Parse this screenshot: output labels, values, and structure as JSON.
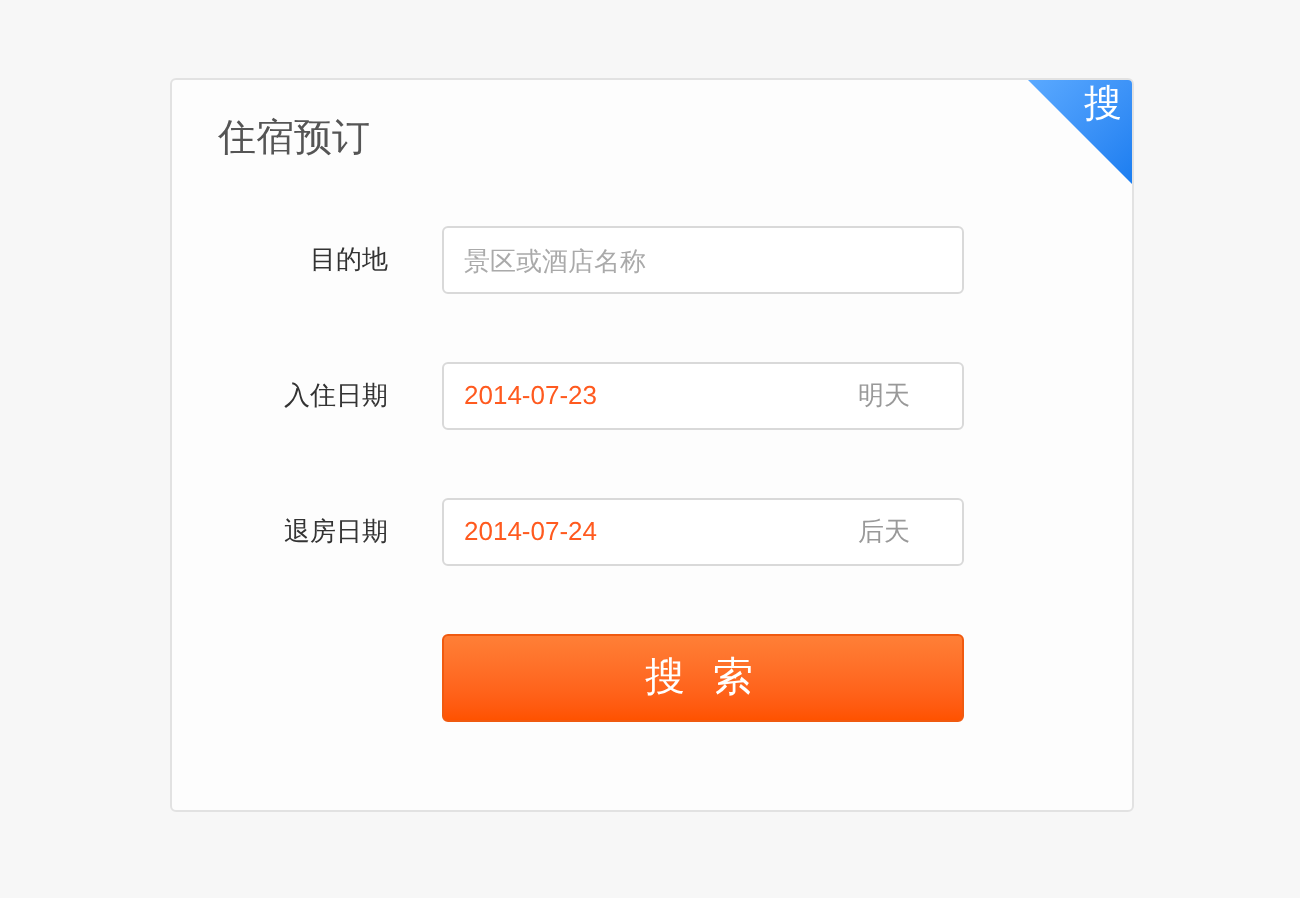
{
  "corner_badge": "搜",
  "title": "住宿预订",
  "fields": [
    {
      "kind": "text",
      "label": "目的地",
      "placeholder": "景区或酒店名称"
    },
    {
      "kind": "date",
      "label": "入住日期",
      "value": "2014-07-23",
      "day_hint": "明天"
    },
    {
      "kind": "date",
      "label": "退房日期",
      "value": "2014-07-24",
      "day_hint": "后天"
    }
  ],
  "search_button": "搜 索"
}
